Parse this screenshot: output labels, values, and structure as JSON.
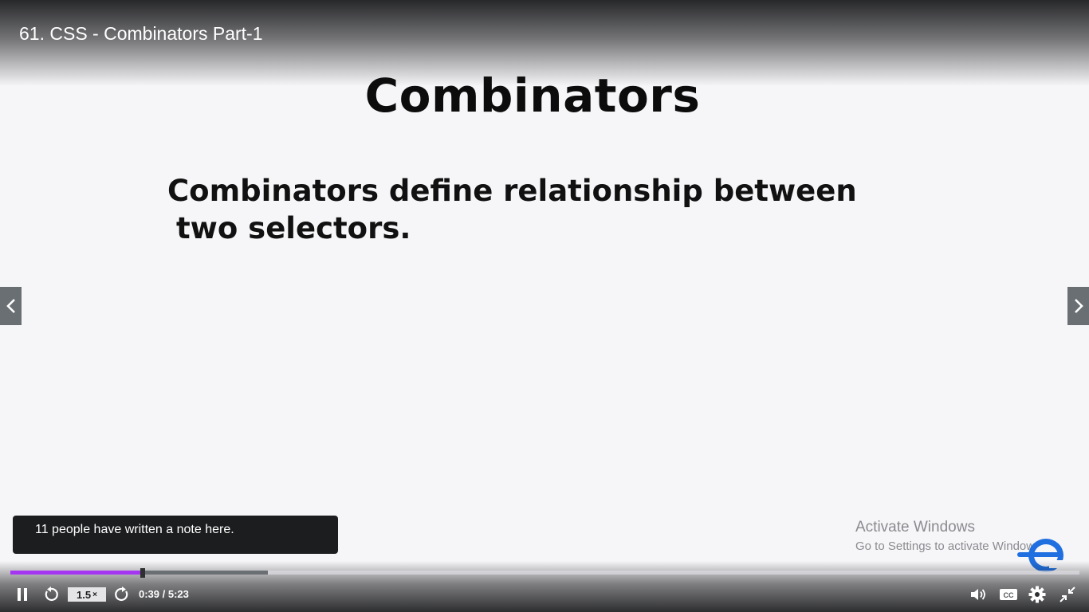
{
  "video": {
    "title": "61. CSS - Combinators Part-1"
  },
  "slide": {
    "heading": "Combinators",
    "body_line1": "Combinators define relationship between",
    "body_line2": "two selectors."
  },
  "note_popup": {
    "text": "11 people have written a note here."
  },
  "watermark": {
    "line1": "Activate Windows",
    "line2": "Go to Settings to activate Windows."
  },
  "player": {
    "speed_value": "1.5",
    "speed_suffix": "×",
    "time": "0:39 / 5:23",
    "played_fraction": 0.124,
    "buffered_fraction": 0.241,
    "accent_color": "#a435f0",
    "icons": [
      "pause-icon",
      "rewind-icon",
      "forward-icon",
      "volume-icon",
      "captions-icon",
      "settings-icon",
      "exit-fullscreen-icon",
      "chevron-left-icon",
      "chevron-right-icon"
    ]
  }
}
